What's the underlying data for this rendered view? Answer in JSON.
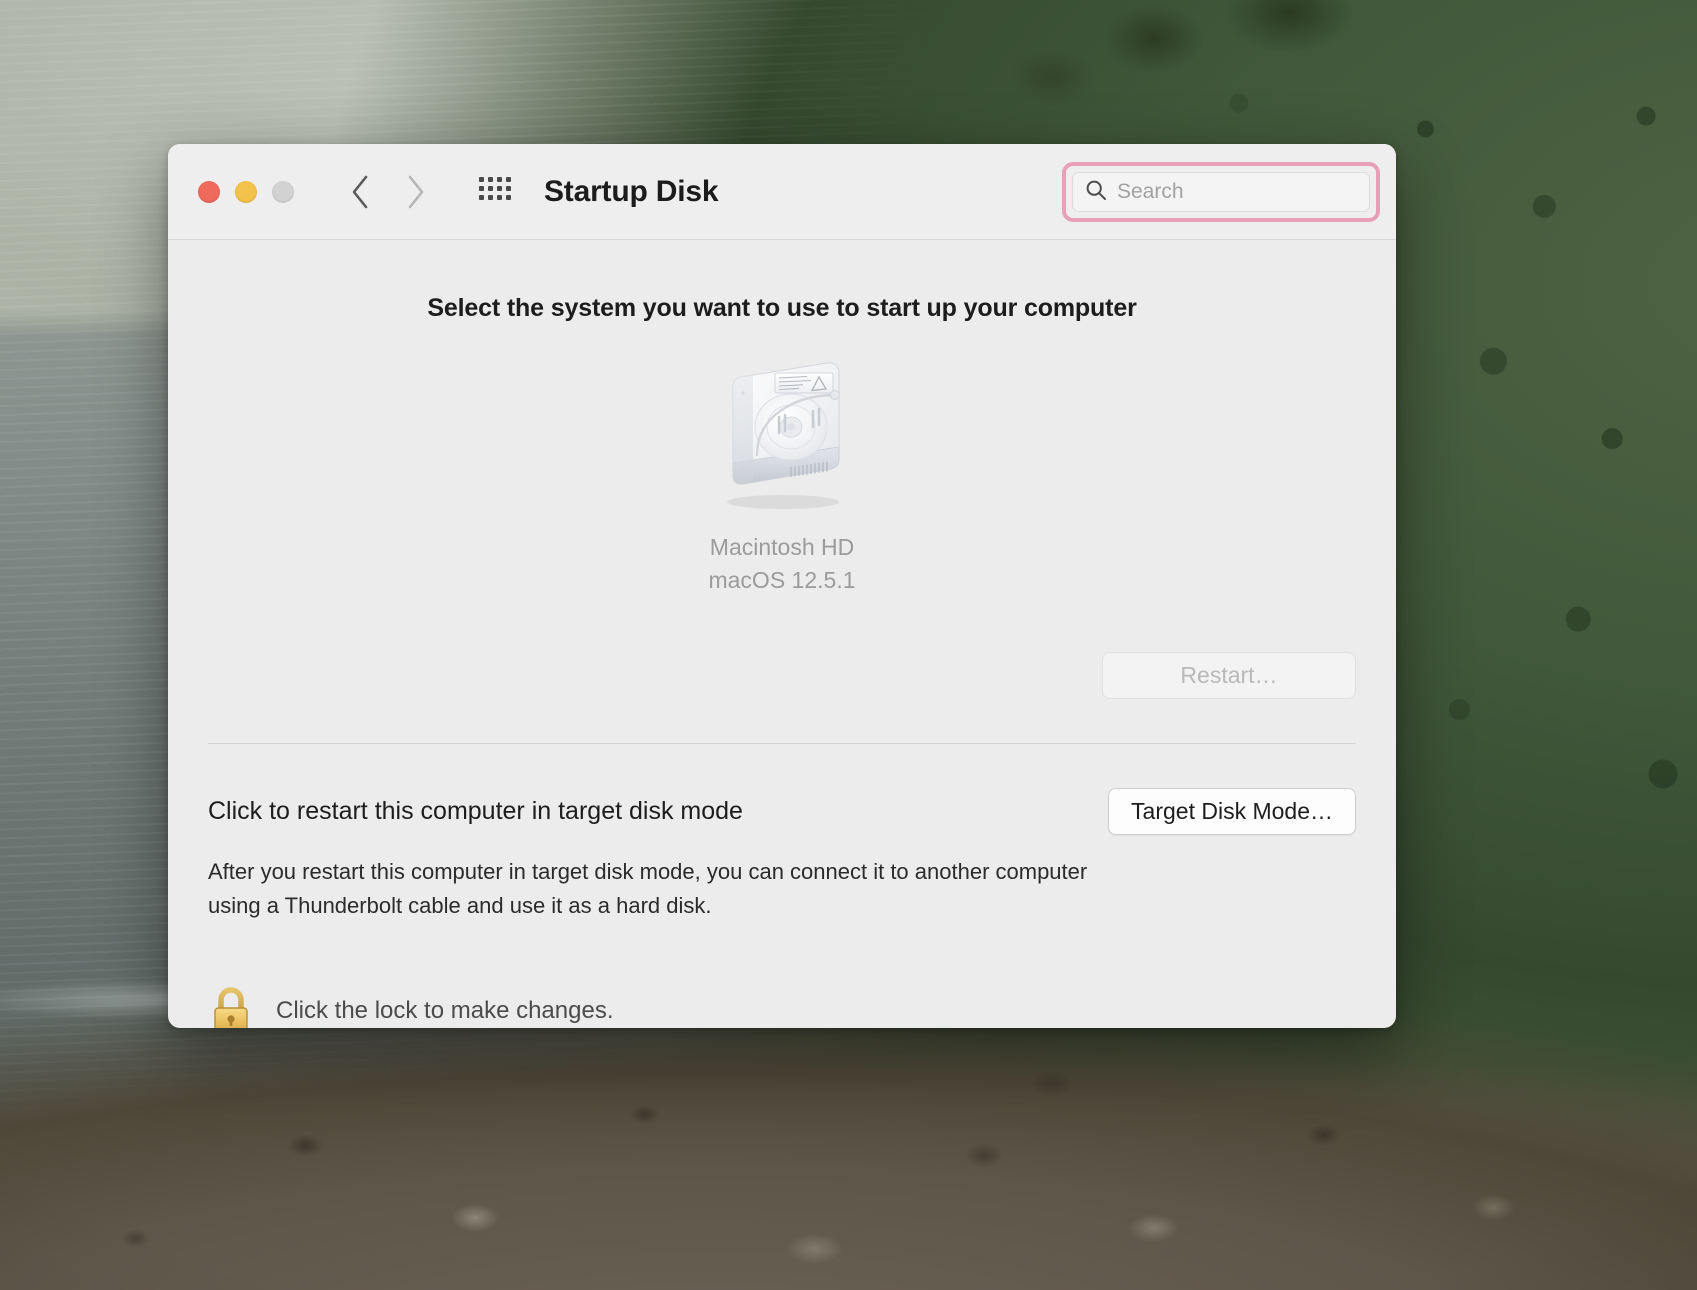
{
  "window": {
    "title": "Startup Disk",
    "traffic_lights": [
      {
        "name": "close",
        "color": "#ef6a5c"
      },
      {
        "name": "minimize",
        "color": "#f2c24a"
      },
      {
        "name": "zoom",
        "color": "#d2d2d2"
      }
    ],
    "nav": {
      "back_label": "Back",
      "forward_label": "Forward",
      "show_all_label": "Show All"
    }
  },
  "search": {
    "value": "",
    "placeholder": "Search",
    "icon": "search-icon",
    "highlight_color": "#e8a0b8"
  },
  "main": {
    "heading": "Select the system you want to use to start up your computer",
    "disk": {
      "icon": "hard-disk-icon",
      "name": "Macintosh HD",
      "os_version": "macOS 12.5.1",
      "selected": false
    },
    "restart_button": {
      "label": "Restart…",
      "enabled": false
    }
  },
  "target_disk_mode": {
    "title": "Click to restart this computer in target disk mode",
    "button_label": "Target Disk Mode…",
    "description": "After you restart this computer in target disk mode, you can connect it to another computer using a Thunderbolt cable and use it as a hard disk."
  },
  "lock": {
    "icon": "lock-closed-icon",
    "text": "Click the lock to make changes."
  }
}
